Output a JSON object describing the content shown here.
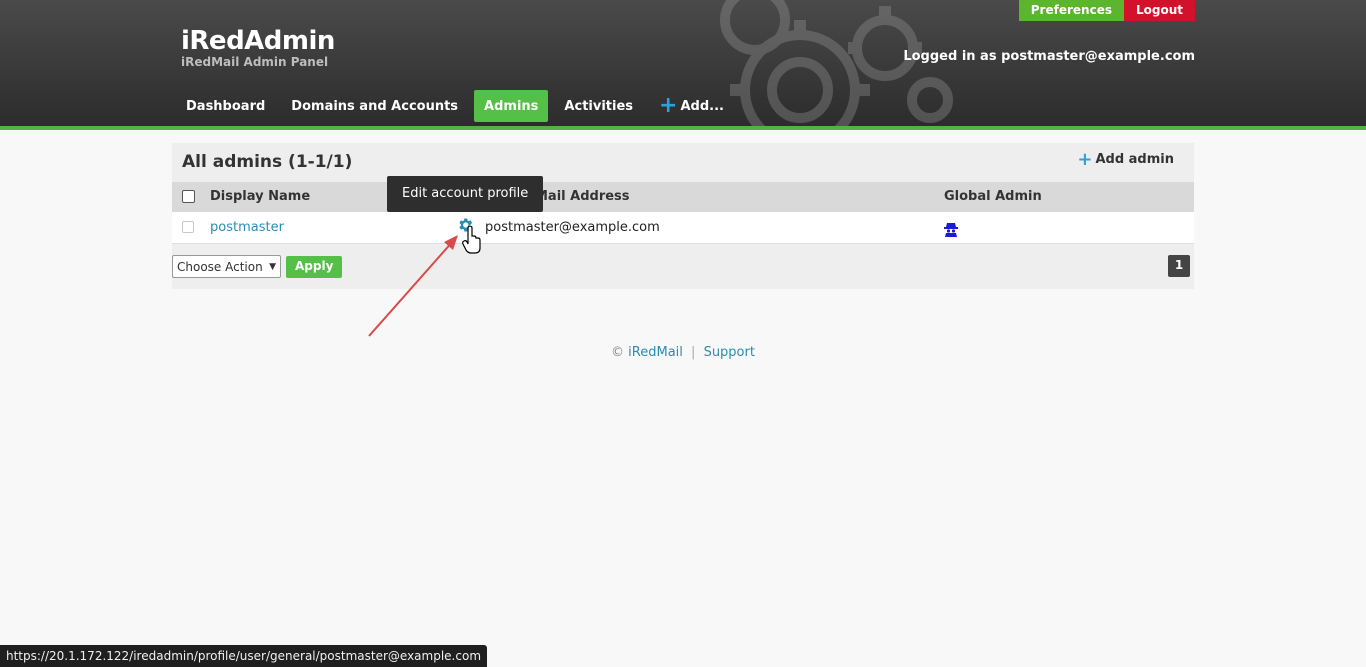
{
  "brand": {
    "title": "iRedAdmin",
    "subtitle": "iRedMail Admin Panel"
  },
  "top_links": {
    "preferences": "Preferences",
    "logout": "Logout"
  },
  "logged_in": "Logged in as postmaster@example.com",
  "nav": {
    "items": [
      {
        "label": "Dashboard",
        "active": false
      },
      {
        "label": "Domains and Accounts",
        "active": false
      },
      {
        "label": "Admins",
        "active": true
      },
      {
        "label": "Activities",
        "active": false
      },
      {
        "label": "Add...",
        "active": false
      }
    ]
  },
  "panel": {
    "title": "All admins (1-1/1)",
    "add_admin": "Add admin",
    "columns": {
      "display_name": "Display Name",
      "email": "Mail Address",
      "global_admin": "Global Admin"
    },
    "rows": [
      {
        "display_name": "postmaster",
        "email": "postmaster@example.com",
        "global_admin": true
      }
    ],
    "action_select": "Choose Action",
    "apply": "Apply",
    "page": "1"
  },
  "tooltip": "Edit account profile",
  "footer": {
    "copyright": "©",
    "iredmail": "iRedMail",
    "separator": "|",
    "support": "Support"
  },
  "status_url": "https://20.1.172.122/iredadmin/profile/user/general/postmaster@example.com",
  "colors": {
    "accent_green": "#55c047",
    "logout_red": "#d3112a",
    "link_blue": "#2a8db0",
    "plus_blue": "#29a3d9"
  },
  "icons": {
    "edit": "gear-icon",
    "global_admin": "spy-agent-icon",
    "add": "plus-icon"
  }
}
